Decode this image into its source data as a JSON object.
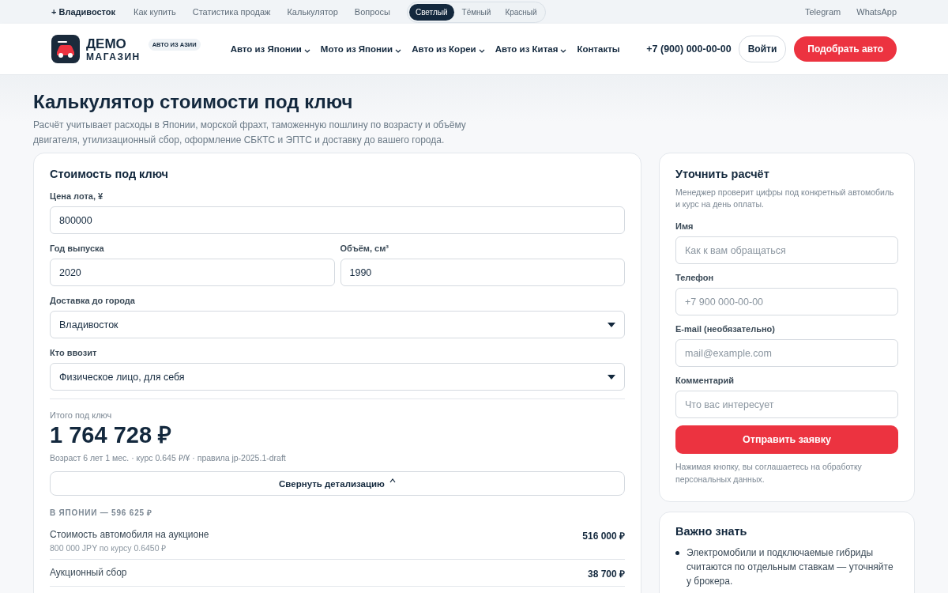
{
  "top_bar": {
    "city": "+ Владивосток",
    "links": [
      "Как купить",
      "Статистика продаж",
      "Калькулятор",
      "Вопросы"
    ],
    "themes": [
      {
        "label": "Светлый",
        "selected": true
      },
      {
        "label": "Тёмный",
        "selected": false
      },
      {
        "label": "Красный",
        "selected": false
      }
    ],
    "social": [
      "Telegram",
      "WhatsApp"
    ]
  },
  "header": {
    "logo_line1": "ДЕМО",
    "logo_line2": "МАГАЗИН",
    "logo_badge": "АВТО ИЗ АЗИИ",
    "nav": [
      {
        "label": "Авто из Японии",
        "dropdown": true
      },
      {
        "label": "Мото из Японии",
        "dropdown": true
      },
      {
        "label": "Авто из Кореи",
        "dropdown": true
      },
      {
        "label": "Авто из Китая",
        "dropdown": true
      },
      {
        "label": "Контакты",
        "dropdown": false
      }
    ],
    "phone": "+7 (900) 000-00-00",
    "login": "Войти",
    "cta": "Подобрать авто"
  },
  "page": {
    "title": "Калькулятор стоимости под ключ",
    "subtitle": "Расчёт учитывает расходы в Японии, морской фрахт, таможенную пошлину по возрасту и объёму двигателя, утилизационный сбор, оформление СБКТС и ЭПТС и доставку до вашего города."
  },
  "calculator": {
    "title": "Стоимость под ключ",
    "rows": [
      [
        {
          "kind": "input",
          "label": "Цена лота, ¥",
          "value": "800000"
        }
      ],
      [
        {
          "kind": "input",
          "label": "Год выпуска",
          "value": "2020"
        },
        {
          "kind": "input",
          "label": "Объём, см³",
          "value": "1990"
        }
      ],
      [
        {
          "kind": "select",
          "label": "Доставка до города",
          "value": "Владивосток"
        }
      ],
      [
        {
          "kind": "select",
          "label": "Кто ввозит",
          "value": "Физическое лицо, для себя"
        }
      ]
    ],
    "total": {
      "label": "Итого под ключ",
      "amount": "1 764 728 ₽",
      "note": "Возраст 6 лет 1 мес. · курс 0.645 ₽/¥ · правила jp-2025.1-draft"
    },
    "details_toggle": {
      "label": "Свернуть детализацию",
      "expanded": true
    },
    "breakdown": [
      {
        "title": "В ЯПОНИИ — 596 625 ₽",
        "items": [
          {
            "label": "Стоимость автомобиля на аукционе",
            "note": "800 000 JPY по курсу 0.6450 ₽",
            "amount": "516 000 ₽"
          },
          {
            "label": "Аукционный сбор",
            "amount": "38 700 ₽"
          }
        ]
      }
    ]
  },
  "lead_form": {
    "title": "Уточнить расчёт",
    "subtitle": "Менеджер проверит цифры под конкретный автомобиль и курс на день оплаты.",
    "fields": [
      {
        "label": "Имя",
        "placeholder": "Как к вам обращаться"
      },
      {
        "label": "Телефон",
        "placeholder": "+7 900 000-00-00"
      },
      {
        "label": "E-mail (необязательно)",
        "placeholder": "mail@example.com"
      },
      {
        "label": "Комментарий",
        "placeholder": "Что вас интересует"
      }
    ],
    "submit": "Отправить заявку",
    "consent": "Нажимая кнопку, вы соглашаетесь на обработку персональных данных."
  },
  "info": {
    "title": "Важно знать",
    "bullets": [
      "Электромобили и подключаемые гибриды считаются по отдельным ставкам — уточняйте у брокера."
    ]
  }
}
